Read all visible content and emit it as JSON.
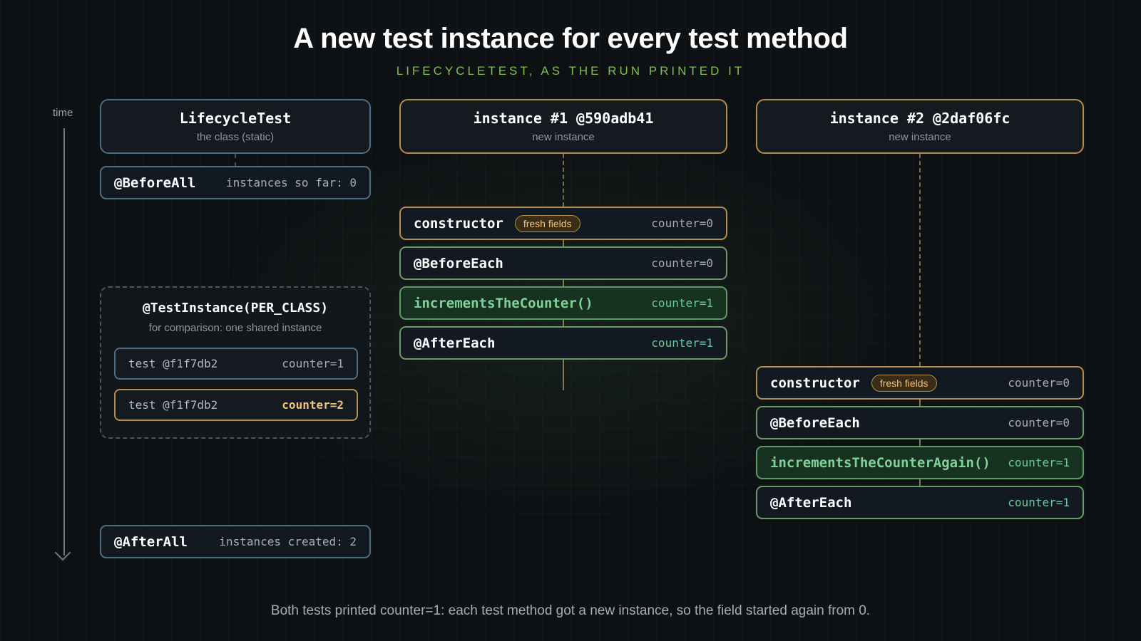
{
  "title": "A new test instance for every test method",
  "subtitle": "LIFECYCLETEST, AS THE RUN PRINTED IT",
  "time_label": "time",
  "footnote": "Both tests printed counter=1: each test method got a new instance, so the field started again from 0.",
  "class_column": {
    "header": {
      "title": "LifecycleTest",
      "subtitle": "the class (static)"
    },
    "before_all": {
      "label": "@BeforeAll",
      "value": "instances so far: 0"
    },
    "after_all": {
      "label": "@AfterAll",
      "value": "instances created: 2"
    },
    "comparison": {
      "title": "@TestInstance(PER_CLASS)",
      "subtitle": "for comparison: one shared instance",
      "rows": [
        {
          "label": "test @f1f7db2",
          "value": "counter=1"
        },
        {
          "label": "test @f1f7db2",
          "value": "counter=2"
        }
      ]
    }
  },
  "instances": [
    {
      "header": {
        "title": "instance #1 @590adb41",
        "subtitle": "new instance"
      },
      "steps": [
        {
          "label": "constructor",
          "badge": "fresh fields",
          "value": "counter=0"
        },
        {
          "label": "@BeforeEach",
          "value": "counter=0"
        },
        {
          "label": "incrementsTheCounter()",
          "value": "counter=1"
        },
        {
          "label": "@AfterEach",
          "value": "counter=1"
        }
      ]
    },
    {
      "header": {
        "title": "instance #2 @2daf06fc",
        "subtitle": "new instance"
      },
      "steps": [
        {
          "label": "constructor",
          "badge": "fresh fields",
          "value": "counter=0"
        },
        {
          "label": "@BeforeEach",
          "value": "counter=0"
        },
        {
          "label": "incrementsTheCounterAgain()",
          "value": "counter=1"
        },
        {
          "label": "@AfterEach",
          "value": "counter=1"
        }
      ]
    }
  ],
  "colors": {
    "background": "#0e1114",
    "subtitle": "#7fbf4f",
    "class_border": "#4f6d82",
    "instance_border": "#b58e4e",
    "test_fill": "#173221",
    "counter_green": "#6cc8a0",
    "badge_text": "#f0c27a"
  }
}
